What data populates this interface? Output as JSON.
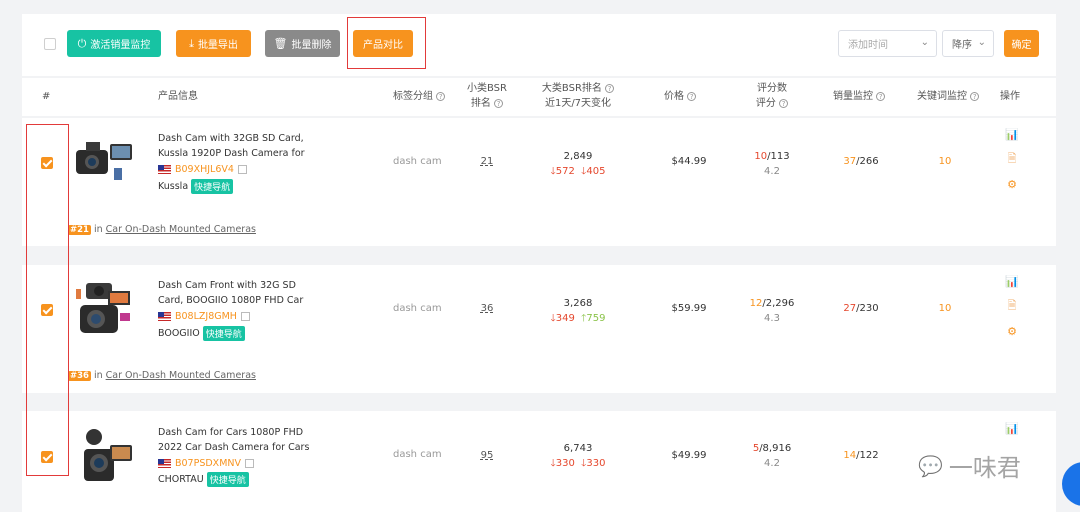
{
  "toolbar": {
    "activate_monitor": "激活销量监控",
    "batch_export": "批量导出",
    "batch_delete": "批量删除",
    "compare": "产品对比",
    "sort_field": "添加时间",
    "sort_order": "降序",
    "confirm": "确定"
  },
  "header": {
    "index": "#",
    "product_info": "产品信息",
    "tag_group": "标签分组",
    "small_bsr_1": "小类BSR",
    "small_bsr_2": "排名",
    "big_bsr_1": "大类BSR排名",
    "big_bsr_2": "近1天/7天变化",
    "price": "价格",
    "rating_1": "评分数",
    "rating_2": "评分",
    "sales_monitor": "销量监控",
    "keyword_monitor": "关键词监控",
    "actions": "操作"
  },
  "products": [
    {
      "title_1": "Dash Cam with 32GB SD Card,",
      "title_2": "Kussla 1920P Dash Camera for",
      "asin": "B09XHJL6V4",
      "brand": "Kussla",
      "nav_tag": "快捷导航",
      "tag": "dash cam",
      "small_bsr": "21",
      "big_bsr": "2,849",
      "change_1d": "572",
      "change_1d_dir": "down",
      "change_7d": "405",
      "change_7d_dir": "down",
      "price": "$44.99",
      "rating_count_new": "10",
      "rating_count_total": "/113",
      "rating": "4.2",
      "sales_new": "37",
      "sales_total": "/266",
      "keyword": "10",
      "category_rank": "#21",
      "category_in": "in",
      "category": "Car On-Dash Mounted Cameras"
    },
    {
      "title_1": "Dash Cam Front with 32G SD",
      "title_2": "Card, BOOGIIO 1080P FHD Car",
      "asin": "B08LZJ8GMH",
      "brand": "BOOGIIO",
      "nav_tag": "快捷导航",
      "tag": "dash cam",
      "small_bsr": "36",
      "big_bsr": "3,268",
      "change_1d": "349",
      "change_1d_dir": "down",
      "change_7d": "759",
      "change_7d_dir": "up",
      "price": "$59.99",
      "rating_count_new": "12",
      "rating_count_total": "/2,296",
      "rating": "4.3",
      "sales_new": "27",
      "sales_total": "/230",
      "keyword": "10",
      "category_rank": "#36",
      "category_in": "in",
      "category": "Car On-Dash Mounted Cameras"
    },
    {
      "title_1": "Dash Cam for Cars 1080P FHD",
      "title_2": "2022 Car Dash Camera for Cars",
      "asin": "B07PSDXMNV",
      "brand": "CHORTAU",
      "nav_tag": "快捷导航",
      "tag": "dash cam",
      "small_bsr": "95",
      "big_bsr": "6,743",
      "change_1d": "330",
      "change_1d_dir": "down",
      "change_7d": "330",
      "change_7d_dir": "down",
      "price": "$49.99",
      "rating_count_new": "5",
      "rating_count_total": "/8,916",
      "rating": "4.2",
      "sales_new": "14",
      "sales_total": "/122",
      "keyword": ""
    }
  ],
  "watermark": "一味君",
  "colors": {
    "accent": "#f7931e",
    "green": "#17c3a3",
    "highlight_box": "#e23a3a"
  }
}
